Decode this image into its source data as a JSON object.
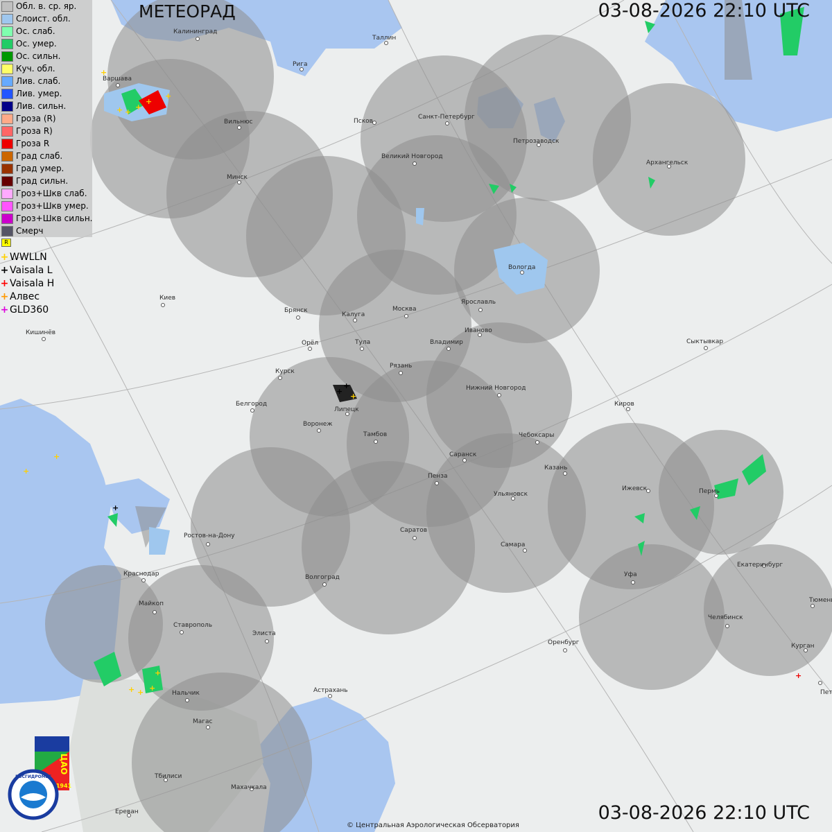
{
  "header": {
    "title": "МЕТЕОРАД",
    "timestamp": "03-08-2026  22:10 UTC"
  },
  "footer": {
    "timestamp": "03-08-2026  22:10 UTC",
    "copyright": "© Центральная Аэрологическая Обсерватория"
  },
  "legend": {
    "items": [
      {
        "label": "Обл. в. ср. яр.",
        "color": "#c0c0c0"
      },
      {
        "label": "Слоист. обл.",
        "color": "#9fc7ee"
      },
      {
        "label": "Ос. слаб.",
        "color": "#7fffaf"
      },
      {
        "label": "Ос. умер.",
        "color": "#22cc66"
      },
      {
        "label": "Ос. сильн.",
        "color": "#009900"
      },
      {
        "label": "Куч. обл.",
        "color": "#ffff66"
      },
      {
        "label": "Лив. слаб.",
        "color": "#66aaff"
      },
      {
        "label": "Лив. умер.",
        "color": "#2255ff"
      },
      {
        "label": "Лив. сильн.",
        "color": "#000088"
      },
      {
        "label": "Гроза (R)",
        "color": "#ffaa88"
      },
      {
        "label": "Гроза R)",
        "color": "#ff6666"
      },
      {
        "label": "Гроза R",
        "color": "#ee0000"
      },
      {
        "label": "Град слаб.",
        "color": "#cc6600"
      },
      {
        "label": "Град умер.",
        "color": "#993300"
      },
      {
        "label": "Град сильн.",
        "color": "#660000"
      },
      {
        "label": "Гроз+Шкв слаб.",
        "color": "#ffaaff"
      },
      {
        "label": "Гроз+Шкв умер.",
        "color": "#ff55ff"
      },
      {
        "label": "Гроз+Шкв сильн.",
        "color": "#cc00cc"
      },
      {
        "label": "Смерч",
        "color": "#555566"
      }
    ],
    "flag_glyph": "R",
    "sensors": [
      {
        "label": "WWLLN",
        "color": "#ffd000"
      },
      {
        "label": "Vaisala L",
        "color": "#000000"
      },
      {
        "label": "Vaisala H",
        "color": "#ff0000"
      },
      {
        "label": "Алвес",
        "color": "#ff9900"
      },
      {
        "label": "GLD360",
        "color": "#dd00dd"
      }
    ]
  },
  "logos": {
    "cao_text": "ЦАО",
    "cao_year": "1941",
    "roshydromet_text": "РОСГИДРОМЕТ"
  },
  "cities": [
    {
      "name": "Калининград"
    },
    {
      "name": "Таллин"
    },
    {
      "name": "Рига"
    },
    {
      "name": "Варшава"
    },
    {
      "name": "Вильнюс"
    },
    {
      "name": "Псков"
    },
    {
      "name": "Санкт-Петербург"
    },
    {
      "name": "Петрозаводск"
    },
    {
      "name": "Архангельск"
    },
    {
      "name": "Великий Новгород"
    },
    {
      "name": "Минск"
    },
    {
      "name": "Вологда"
    },
    {
      "name": "Киев"
    },
    {
      "name": "Брянск"
    },
    {
      "name": "Калуга"
    },
    {
      "name": "Москва"
    },
    {
      "name": "Ярославль"
    },
    {
      "name": "Кишинёв"
    },
    {
      "name": "Иваново"
    },
    {
      "name": "Орёл"
    },
    {
      "name": "Тула"
    },
    {
      "name": "Владимир"
    },
    {
      "name": "Сыктывкар"
    },
    {
      "name": "Курск"
    },
    {
      "name": "Рязань"
    },
    {
      "name": "Нижний Новгород"
    },
    {
      "name": "Белгород"
    },
    {
      "name": "Липецк"
    },
    {
      "name": "Киров"
    },
    {
      "name": "Воронеж"
    },
    {
      "name": "Тамбов"
    },
    {
      "name": "Чебоксары"
    },
    {
      "name": "Саранск"
    },
    {
      "name": "Казань"
    },
    {
      "name": "Пенза"
    },
    {
      "name": "Ижевск"
    },
    {
      "name": "Пермь"
    },
    {
      "name": "Ульяновск"
    },
    {
      "name": "Ростов-на-Дону"
    },
    {
      "name": "Саратов"
    },
    {
      "name": "Самара"
    },
    {
      "name": "Краснодар"
    },
    {
      "name": "Волгоград"
    },
    {
      "name": "Уфа"
    },
    {
      "name": "Екатеринбург"
    },
    {
      "name": "Майкоп"
    },
    {
      "name": "Тюмень"
    },
    {
      "name": "Ставрополь"
    },
    {
      "name": "Челябинск"
    },
    {
      "name": "Элиста"
    },
    {
      "name": "Оренбург"
    },
    {
      "name": "Курган"
    },
    {
      "name": "Нальчик"
    },
    {
      "name": "Астрахань"
    },
    {
      "name": "Магас"
    },
    {
      "name": "Петропавловск"
    },
    {
      "name": "Тбилиси"
    },
    {
      "name": "Махачкала"
    },
    {
      "name": "Ереван"
    }
  ]
}
